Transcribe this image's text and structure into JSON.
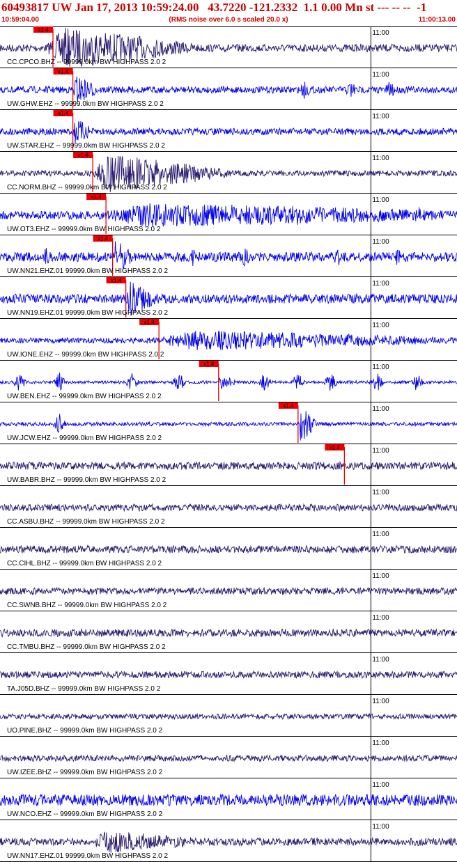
{
  "header": {
    "title": "60493817 UW Jan 17, 2013 10:59:24.00   43.7220 -121.2332  1.1 0.00 Mn st --- -- --  -1",
    "start_time": "10:59:04.00",
    "noise_note": "(RMS noise over 6.0 s scaled 20.0 x)",
    "end_time": "11:00:13.00"
  },
  "colors": {
    "header_text": "#cc0000",
    "trace_navy": "#2a1a6e",
    "trace_blue": "#0000ee",
    "pick": "#ee0000",
    "separator": "#000000"
  },
  "chart_data": {
    "type": "line",
    "x_range": [
      "10:59:04.00",
      "11:00:13.00"
    ],
    "tick_label": "11:00",
    "tick_time": "11:00:00",
    "pick_label": "x1.4",
    "traces": [
      {
        "label": "CC.CPCO.BHZ -- 99999.0km BW  HIGHPASS  2.0  2",
        "color": "navy",
        "pick": "10:59:12.00",
        "event_start": "10:59:11.00",
        "event_end": "10:59:34.00",
        "event_amp": 1.0,
        "noise": 0.2,
        "bursts": []
      },
      {
        "label": "UW.GHW.EHZ -- 99999.0km BW  HIGHPASS  2.0  2",
        "color": "blue",
        "pick": "10:59:15.00",
        "event_start": "10:59:15.00",
        "event_end": "10:59:19.00",
        "event_amp": 0.7,
        "noise": 0.18,
        "bursts": [
          "10:59:50.00",
          "10:59:57.00",
          "11:00:03.00"
        ]
      },
      {
        "label": "UW.STAR.EHZ -- 99999.0km BW  HIGHPASS  2.0  2",
        "color": "blue",
        "pick": "10:59:15.00",
        "event_start": "10:59:15.00",
        "event_end": "10:59:18.00",
        "event_amp": 0.6,
        "noise": 0.18,
        "bursts": []
      },
      {
        "label": "CC.NORM.BHZ -- 99999.0km BW  HIGHPASS  2.0  2",
        "color": "navy",
        "pick": "10:59:18.00",
        "event_start": "10:59:18.00",
        "event_end": "10:59:39.00",
        "event_amp": 1.0,
        "noise": 0.15,
        "bursts": []
      },
      {
        "label": "UW.OT3.EHZ -- 99999.0km BW  HIGHPASS  2.0  2",
        "color": "blue",
        "pick": "10:59:20.00",
        "event_start": "10:59:20.00",
        "event_end": "11:00:13.00",
        "event_amp": 0.5,
        "noise": 0.22,
        "bursts": [
          "10:59:49.00",
          "11:00:07.00"
        ]
      },
      {
        "label": "UW.NN21.EHZ.01 99999.0km BW  HIGHPASS  2.0  2",
        "color": "blue",
        "pick": "10:59:21.00",
        "event_start": "10:59:21.00",
        "event_end": "10:59:24.00",
        "event_amp": 0.8,
        "noise": 0.25,
        "bursts": [
          "10:59:11.00",
          "10:59:33.00",
          "10:59:41.00",
          "10:59:55.00",
          "11:00:04.00"
        ]
      },
      {
        "label": "UW.NN19.EHZ.01 99999.0km BW  HIGHPASS  2.0  2",
        "color": "blue",
        "pick": "10:59:23.00",
        "event_start": "10:59:23.00",
        "event_end": "10:59:28.00",
        "event_amp": 0.8,
        "noise": 0.25,
        "bursts": []
      },
      {
        "label": "UW.IONE.EHZ -- 99999.0km BW  HIGHPASS  2.0  2",
        "color": "blue",
        "pick": "10:59:28.00",
        "event_start": "10:59:28.00",
        "event_end": "11:00:13.00",
        "event_amp": 0.45,
        "noise": 0.15,
        "bursts": []
      },
      {
        "label": "UW.BEN.EHZ -- 99999.0km BW  HIGHPASS  2.0  2",
        "color": "blue",
        "pick": "10:59:37.00",
        "event_start": "10:59:37.00",
        "event_end": "10:59:40.00",
        "event_amp": 0.4,
        "noise": 0.08,
        "bursts": [
          "10:59:07.00",
          "10:59:13.00",
          "10:59:24.00",
          "10:59:31.00",
          "10:59:44.00",
          "10:59:49.00",
          "10:59:54.00",
          "11:00:01.00",
          "11:00:07.00"
        ]
      },
      {
        "label": "UW.JCW.EHZ -- 99999.0km BW  HIGHPASS  2.0  2",
        "color": "blue",
        "pick": "10:59:49.00",
        "event_start": "10:59:49.00",
        "event_end": "10:59:52.00",
        "event_amp": 1.0,
        "noise": 0.1,
        "bursts": [
          "10:59:13.00"
        ]
      },
      {
        "label": "UW.BABR.BHZ -- 99999.0km BW  HIGHPASS  2.0  2",
        "color": "navy",
        "pick": "10:59:56.00",
        "event_start": "",
        "event_end": "",
        "event_amp": 0,
        "noise": 0.2,
        "bursts": []
      },
      {
        "label": "CC.ASBU.BHZ -- 99999.0km BW  HIGHPASS  2.0  2",
        "color": "navy",
        "pick": "",
        "event_start": "",
        "event_end": "",
        "event_amp": 0,
        "noise": 0.18,
        "bursts": []
      },
      {
        "label": "CC.CIHL.BHZ -- 99999.0km BW  HIGHPASS  2.0  2",
        "color": "navy",
        "pick": "",
        "event_start": "",
        "event_end": "",
        "event_amp": 0,
        "noise": 0.2,
        "bursts": []
      },
      {
        "label": "CC.SWNB.BHZ -- 99999.0km BW  HIGHPASS  2.0  2",
        "color": "navy",
        "pick": "",
        "event_start": "",
        "event_end": "",
        "event_amp": 0,
        "noise": 0.18,
        "bursts": []
      },
      {
        "label": "CC.TMBU.BHZ -- 99999.0km BW  HIGHPASS  2.0  2",
        "color": "navy",
        "pick": "",
        "event_start": "",
        "event_end": "",
        "event_amp": 0,
        "noise": 0.2,
        "bursts": []
      },
      {
        "label": "TA.J05D.BHZ -- 99999.0km BW  HIGHPASS  2.0  2",
        "color": "navy",
        "pick": "",
        "event_start": "",
        "event_end": "",
        "event_amp": 0,
        "noise": 0.18,
        "bursts": []
      },
      {
        "label": "UO.PINE.BHZ -- 99999.0km BW  HIGHPASS  2.0  2",
        "color": "navy",
        "pick": "",
        "event_start": "",
        "event_end": "",
        "event_amp": 0,
        "noise": 0.14,
        "bursts": []
      },
      {
        "label": "UW.IZEE.BHZ -- 99999.0km BW  HIGHPASS  2.0  2",
        "color": "navy",
        "pick": "",
        "event_start": "",
        "event_end": "",
        "event_amp": 0,
        "noise": 0.16,
        "bursts": []
      },
      {
        "label": "UW.NCO.EHZ -- 99999.0km BW  HIGHPASS  2.0  2",
        "color": "blue",
        "pick": "",
        "event_start": "",
        "event_end": "",
        "event_amp": 0,
        "noise": 0.3,
        "bursts": []
      },
      {
        "label": "UW.NN17.EHZ.01 99999.0km BW  HIGHPASS  2.0  2",
        "color": "navy",
        "pick": "",
        "event_start": "10:59:18.00",
        "event_end": "10:59:34.00",
        "event_amp": 0.45,
        "noise": 0.2,
        "bursts": []
      }
    ]
  }
}
